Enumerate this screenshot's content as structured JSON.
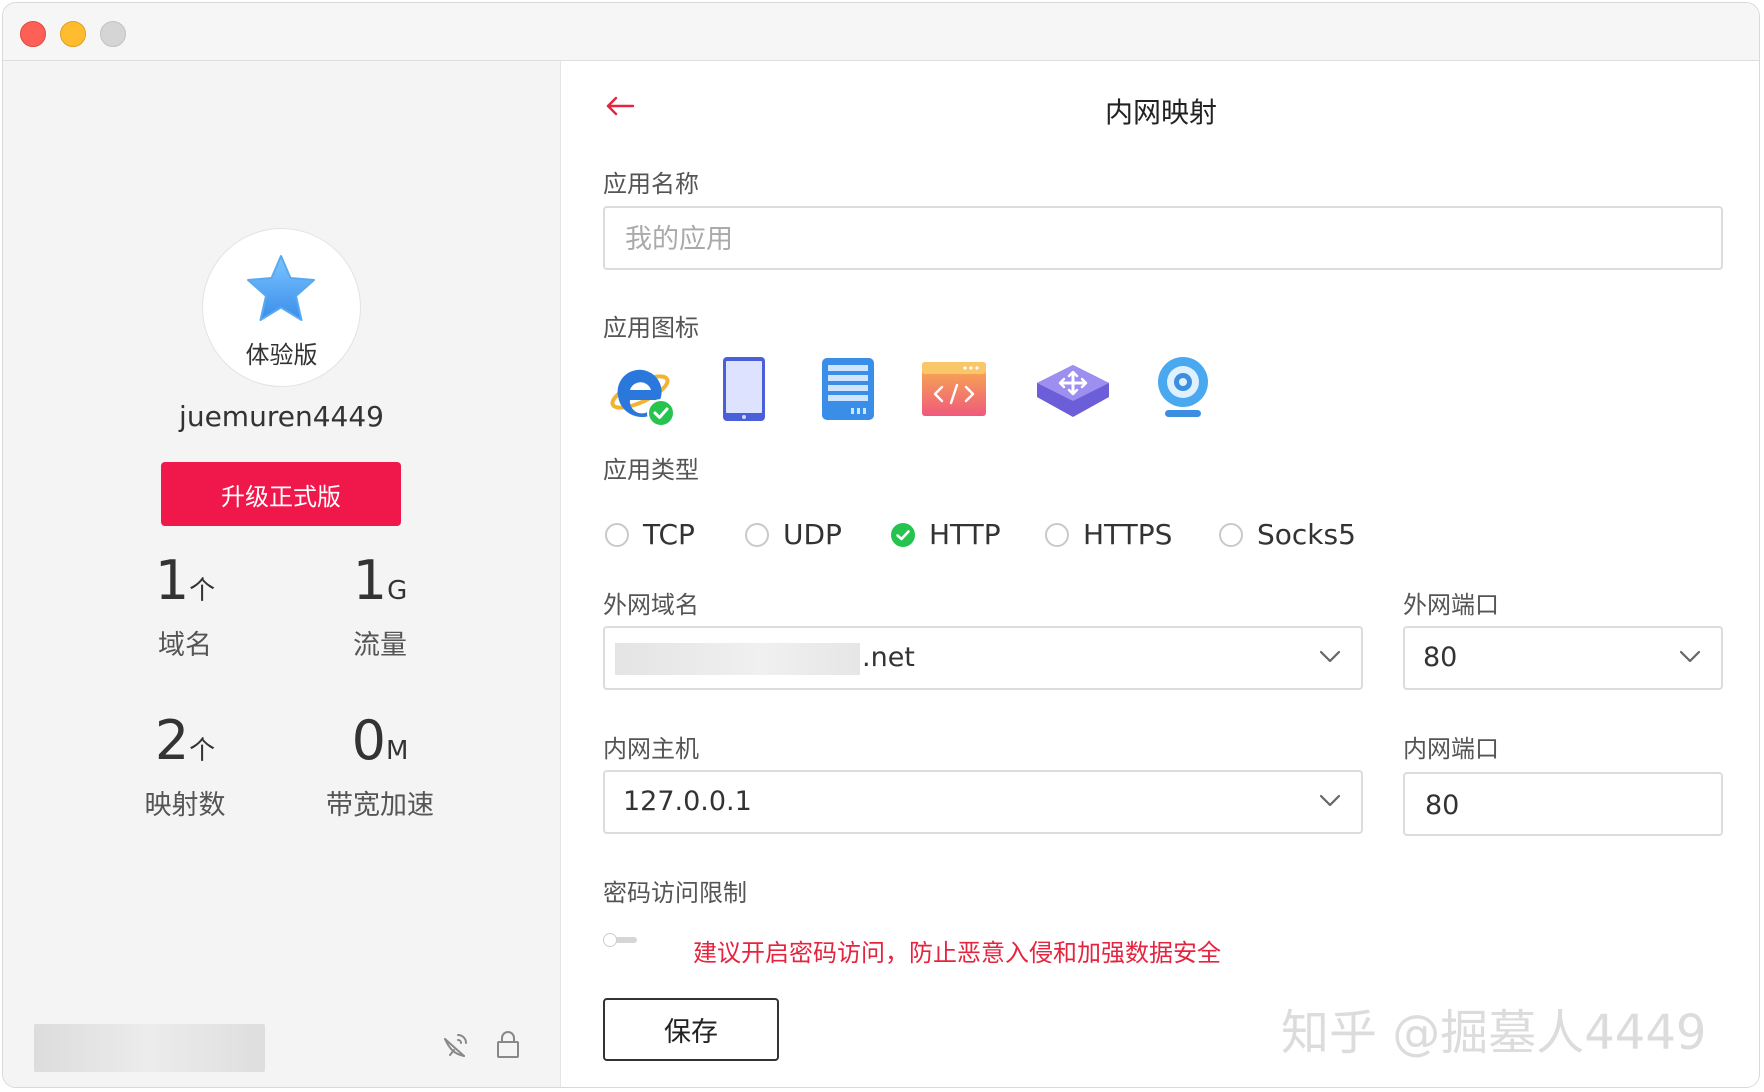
{
  "sidebar": {
    "badge": "体验版",
    "username": "juemuren4449",
    "upgrade_label": "升级正式版",
    "stats": [
      {
        "value": "1",
        "unit": "个",
        "label": "域名"
      },
      {
        "value": "1",
        "unit": "G",
        "label": "流量"
      },
      {
        "value": "2",
        "unit": "个",
        "label": "映射数"
      },
      {
        "value": "0",
        "unit": "M",
        "label": "带宽加速"
      }
    ]
  },
  "main": {
    "title": "内网映射",
    "app_name": {
      "label": "应用名称",
      "placeholder": "我的应用"
    },
    "app_icon": {
      "label": "应用图标"
    },
    "app_type": {
      "label": "应用类型",
      "options": [
        "TCP",
        "UDP",
        "HTTP",
        "HTTPS",
        "Socks5"
      ],
      "selected": "HTTP"
    },
    "domain": {
      "label": "外网域名",
      "suffix": ".net"
    },
    "ext_port": {
      "label": "外网端口",
      "value": "80"
    },
    "host": {
      "label": "内网主机",
      "value": "127.0.0.1"
    },
    "int_port": {
      "label": "内网端口",
      "value": "80"
    },
    "password": {
      "label": "密码访问限制",
      "warning": "建议开启密码访问，防止恶意入侵和加强数据安全"
    },
    "save_label": "保存"
  },
  "watermark": "知乎 @掘墓人4449",
  "colors": {
    "accent": "#f0184b",
    "success": "#26c34e",
    "warning": "#e5243f"
  }
}
